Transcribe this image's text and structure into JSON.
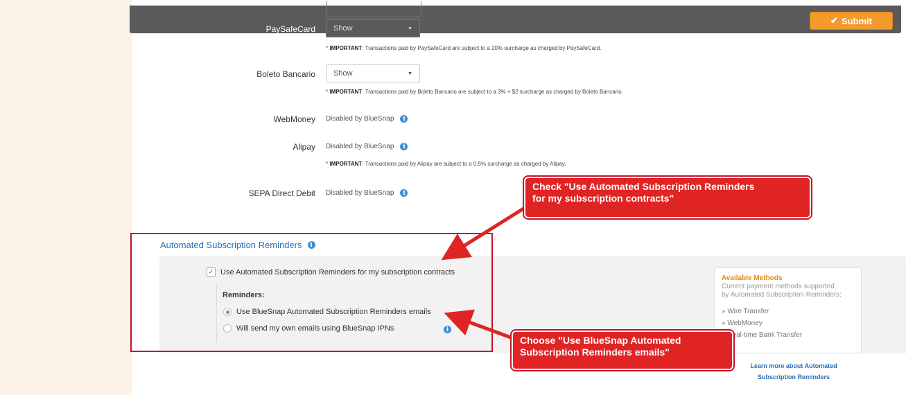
{
  "header": {
    "submit_label": "Submit",
    "submit_icon": "checkmark-icon"
  },
  "payment_methods": {
    "paysafecard": {
      "label": "PaySafeCard",
      "value": "Show",
      "note_bold": "IMPORTANT",
      "note_text": ": Transactions paid by PaySafeCard are subject to a 20% surcharge as charged by PaySafeCard."
    },
    "boleto": {
      "label": "Boleto Bancario",
      "value": "Show",
      "note_bold": "IMPORTANT",
      "note_text": ": Transactions paid by Boleto Bancario are subject to a 3% + $2 surcharge as charged by Boleto Bancario."
    },
    "webmoney": {
      "label": "WebMoney",
      "status": "Disabled by BlueSnap"
    },
    "alipay": {
      "label": "Alipay",
      "status": "Disabled by BlueSnap",
      "note_bold": "IMPORTANT",
      "note_text": ": Transactions paid by Alipay are subject to a 0.5% surcharge as charged by Alipay."
    },
    "sepa": {
      "label": "SEPA Direct Debit",
      "status": "Disabled by BlueSnap"
    }
  },
  "subscription_reminders": {
    "title": "Automated Subscription Reminders",
    "checkbox_label": "Use Automated Subscription Reminders for my subscription contracts",
    "checkbox_checked": true,
    "reminders_heading": "Reminders:",
    "options": [
      {
        "label": "Use BlueSnap Automated Subscription Reminders emails",
        "selected": true
      },
      {
        "label": "Will send my own emails using BlueSnap IPNs",
        "selected": false
      }
    ]
  },
  "available_methods": {
    "title": "Available Methods",
    "desc_line1": "Current payment methods supported",
    "desc_line2": "by Automated Subscription Reminders:",
    "items": [
      "» Wire Transfer",
      "» WebMoney",
      "» Real-time Bank Transfer"
    ],
    "learn_more_line1": "Learn more about Automated",
    "learn_more_line2": "Subscription Reminders"
  },
  "callouts": {
    "first_line1": "Check \"Use Automated Subscription Reminders",
    "first_line2": "for my subscription contracts\"",
    "second_line1": "Choose \"Use BlueSnap Automated",
    "second_line2": "Subscription Reminders emails\""
  },
  "colors": {
    "accent": "#f39a2b",
    "link": "#2a6db5",
    "callout": "#e02424",
    "info": "#3d8fd6"
  }
}
